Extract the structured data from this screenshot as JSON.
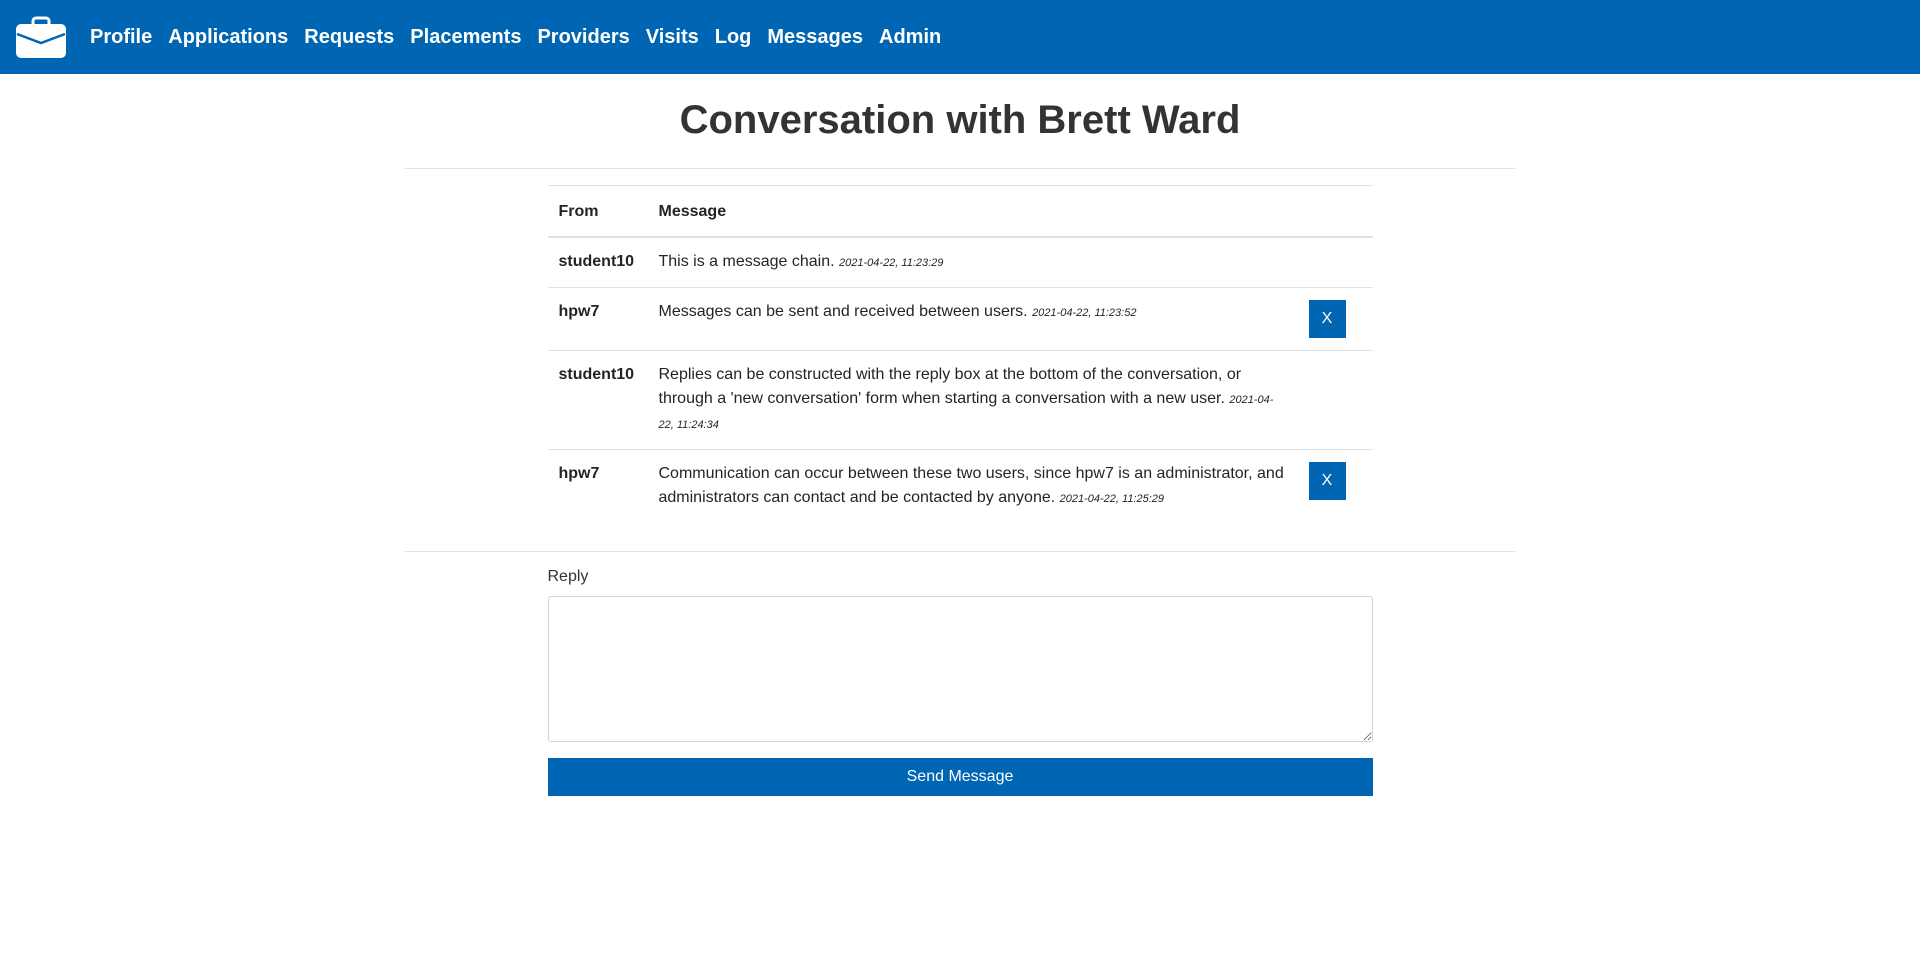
{
  "nav": {
    "brand_icon": "briefcase-icon",
    "items": [
      "Profile",
      "Applications",
      "Requests",
      "Placements",
      "Providers",
      "Visits",
      "Log",
      "Messages",
      "Admin"
    ]
  },
  "page": {
    "title": "Conversation with Brett Ward"
  },
  "table": {
    "headers": {
      "from": "From",
      "message": "Message"
    },
    "rows": [
      {
        "from": "student10",
        "message": "This is a message chain.",
        "timestamp": "2021-04-22, 11:23:29",
        "delete": ""
      },
      {
        "from": "hpw7",
        "message": "Messages can be sent and received between users.",
        "timestamp": "2021-04-22, 11:23:52",
        "delete": "X"
      },
      {
        "from": "student10",
        "message": "Replies can be constructed with the reply box at the bottom of the conversation, or through a 'new conversation' form when starting a conversation with a new user.",
        "timestamp": "2021-04-22, 11:24:34",
        "delete": ""
      },
      {
        "from": "hpw7",
        "message": "Communication can occur between these two users, since hpw7 is an administrator, and administrators can contact and be contacted by anyone.",
        "timestamp": "2021-04-22, 11:25:29",
        "delete": "X"
      }
    ]
  },
  "reply": {
    "label": "Reply",
    "value": "",
    "send_label": "Send Message"
  },
  "colors": {
    "primary": "#0066b3"
  }
}
